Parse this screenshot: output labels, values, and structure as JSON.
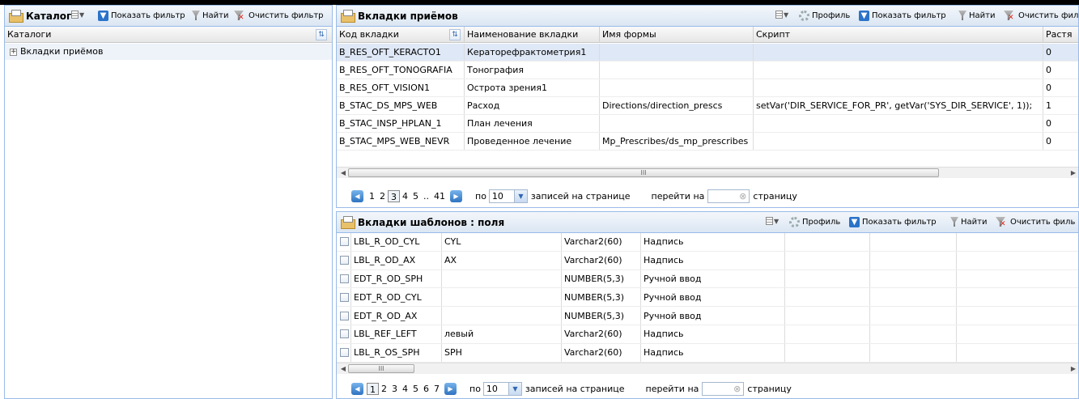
{
  "toolbar_labels": {
    "show_filter": "Показать фильтр",
    "find": "Найти",
    "clear_filter": "Очистить фильтр",
    "clear_filter_cut": "Очистить филь",
    "profile": "Профиль"
  },
  "left": {
    "title": "Каталог",
    "column": "Каталоги",
    "tree_item": "Вкладки приёмов"
  },
  "top_grid": {
    "title": "Вкладки приёмов",
    "columns": [
      "Код вкладки",
      "Наименование вкладки",
      "Имя формы",
      "Скрипт",
      "Растя"
    ],
    "rows": [
      [
        "B_RES_OFT_KERACTO1",
        "Кераторефрактометрия1",
        "",
        "",
        "0"
      ],
      [
        "B_RES_OFT_TONOGRAFIA",
        "Тонография",
        "",
        "",
        "0"
      ],
      [
        "B_RES_OFT_VISION1",
        "Острота зрения1",
        "",
        "",
        "0"
      ],
      [
        "B_STAC_DS_MPS_WEB",
        "Расход",
        "Directions/direction_prescs",
        "setVar('DIR_SERVICE_FOR_PR', getVar('SYS_DIR_SERVICE', 1));",
        "1"
      ],
      [
        "B_STAC_INSP_HPLAN_1",
        "План лечения",
        "",
        "",
        "0"
      ],
      [
        "B_STAC_MPS_WEB_NEVR",
        "Проведенное лечение",
        "Mp_Prescribes/ds_mp_prescribes",
        "",
        "0"
      ]
    ],
    "pager": {
      "pages": [
        "1",
        "2",
        "3",
        "4",
        "5",
        "..",
        "41"
      ],
      "current": "3",
      "per_label": "по",
      "per_value": "10",
      "records_label": "записей на странице",
      "goto_label": "перейти на",
      "page_label": "страницу"
    }
  },
  "bottom_grid": {
    "title": "Вкладки шаблонов : поля",
    "rows": [
      [
        "LBL_R_OD_CYL",
        "CYL",
        "Varchar2(60)",
        "Надпись"
      ],
      [
        "LBL_R_OD_AX",
        "AX",
        "Varchar2(60)",
        "Надпись"
      ],
      [
        "EDT_R_OD_SPH",
        "",
        "NUMBER(5,3)",
        "Ручной ввод"
      ],
      [
        "EDT_R_OD_CYL",
        "",
        "NUMBER(5,3)",
        "Ручной ввод"
      ],
      [
        "EDT_R_OD_AX",
        "",
        "NUMBER(5,3)",
        "Ручной ввод"
      ],
      [
        "LBL_REF_LEFT",
        "левый",
        "Varchar2(60)",
        "Надпись"
      ],
      [
        "LBL_R_OS_SPH",
        "SPH",
        "Varchar2(60)",
        "Надпись"
      ]
    ],
    "pager": {
      "pages": [
        "1",
        "2",
        "3",
        "4",
        "5",
        "6",
        "7"
      ],
      "current": "1",
      "per_label": "по",
      "per_value": "10",
      "records_label": "записей на странице",
      "goto_label": "перейти на",
      "page_label": "страницу"
    }
  },
  "scroll_thumb_label": "III"
}
